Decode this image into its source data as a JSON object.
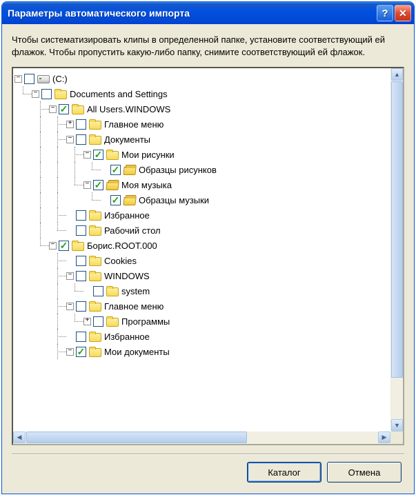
{
  "window": {
    "title": "Параметры автоматического импорта",
    "help_symbol": "?",
    "close_symbol": "✕"
  },
  "instructions": "Чтобы систематизировать клипы в определенной папке, установите соответствующий ей флажок. Чтобы пропустить какую-либо папку, снимите соответствующий ей флажок.",
  "buttons": {
    "catalog": "Каталог",
    "cancel": "Отмена"
  },
  "expanders": {
    "plus": "+",
    "minus": "−"
  },
  "tree": [
    {
      "depth": 0,
      "expander": "minus",
      "checked": false,
      "icon": "drive",
      "label": "(C:)",
      "lines": []
    },
    {
      "depth": 1,
      "expander": "minus",
      "checked": false,
      "icon": "folder",
      "label": "Documents and Settings",
      "lines": [
        "elbow"
      ]
    },
    {
      "depth": 2,
      "expander": "minus",
      "checked": true,
      "icon": "folder",
      "label": "All Users.WINDOWS",
      "lines": [
        "blank",
        "tee"
      ]
    },
    {
      "depth": 3,
      "expander": "plus",
      "checked": false,
      "icon": "folder",
      "label": "Главное меню",
      "lines": [
        "blank",
        "vline",
        "tee"
      ]
    },
    {
      "depth": 3,
      "expander": "minus",
      "checked": false,
      "icon": "folder",
      "label": "Документы",
      "lines": [
        "blank",
        "vline",
        "tee"
      ]
    },
    {
      "depth": 4,
      "expander": "minus",
      "checked": true,
      "icon": "folder",
      "label": "Мои рисунки",
      "lines": [
        "blank",
        "vline",
        "vline",
        "tee"
      ]
    },
    {
      "depth": 5,
      "expander": null,
      "checked": true,
      "icon": "folder-open",
      "label": "Образцы рисунков",
      "lines": [
        "blank",
        "vline",
        "vline",
        "vline",
        "elbow"
      ]
    },
    {
      "depth": 4,
      "expander": "minus",
      "checked": true,
      "icon": "folder-open",
      "label": "Моя музыка",
      "lines": [
        "blank",
        "vline",
        "vline",
        "elbow"
      ]
    },
    {
      "depth": 5,
      "expander": null,
      "checked": true,
      "icon": "folder-open",
      "label": "Образцы музыки",
      "lines": [
        "blank",
        "vline",
        "vline",
        "blank",
        "elbow"
      ]
    },
    {
      "depth": 3,
      "expander": null,
      "checked": false,
      "icon": "folder",
      "label": "Избранное",
      "lines": [
        "blank",
        "vline",
        "tee"
      ]
    },
    {
      "depth": 3,
      "expander": null,
      "checked": false,
      "icon": "folder",
      "label": "Рабочий стол",
      "lines": [
        "blank",
        "vline",
        "elbow"
      ]
    },
    {
      "depth": 2,
      "expander": "minus",
      "checked": true,
      "icon": "folder",
      "label": "Борис.ROOT.000",
      "lines": [
        "blank",
        "elbow"
      ]
    },
    {
      "depth": 3,
      "expander": null,
      "checked": false,
      "icon": "folder",
      "label": "Cookies",
      "lines": [
        "blank",
        "blank",
        "tee"
      ]
    },
    {
      "depth": 3,
      "expander": "minus",
      "checked": false,
      "icon": "folder",
      "label": "WINDOWS",
      "lines": [
        "blank",
        "blank",
        "tee"
      ]
    },
    {
      "depth": 4,
      "expander": null,
      "checked": false,
      "icon": "folder",
      "label": "system",
      "lines": [
        "blank",
        "blank",
        "vline",
        "elbow"
      ]
    },
    {
      "depth": 3,
      "expander": "minus",
      "checked": false,
      "icon": "folder",
      "label": "Главное меню",
      "lines": [
        "blank",
        "blank",
        "tee"
      ]
    },
    {
      "depth": 4,
      "expander": "plus",
      "checked": false,
      "icon": "folder",
      "label": "Программы",
      "lines": [
        "blank",
        "blank",
        "vline",
        "elbow"
      ]
    },
    {
      "depth": 3,
      "expander": null,
      "checked": false,
      "icon": "folder",
      "label": "Избранное",
      "lines": [
        "blank",
        "blank",
        "tee"
      ]
    },
    {
      "depth": 3,
      "expander": "minus",
      "checked": true,
      "icon": "folder",
      "label": "Мои документы",
      "lines": [
        "blank",
        "blank",
        "tee"
      ]
    }
  ]
}
